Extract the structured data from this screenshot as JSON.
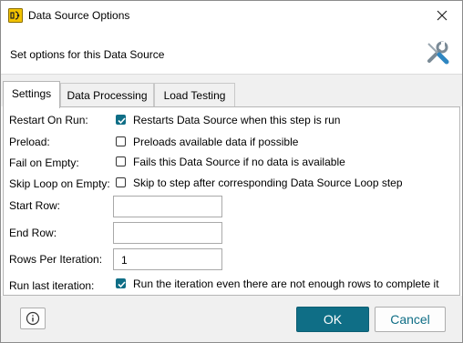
{
  "window": {
    "title": "Data Source Options",
    "icon": "data-source-icon",
    "close_icon": "close-icon"
  },
  "header": {
    "text": "Set options for this Data Source",
    "icon": "tools-icon"
  },
  "tabs": [
    {
      "label": "Settings",
      "active": true
    },
    {
      "label": "Data Processing",
      "active": false
    },
    {
      "label": "Load Testing",
      "active": false
    }
  ],
  "settings": {
    "restart_on_run": {
      "label": "Restart On Run:",
      "checked": true,
      "text": "Restarts Data Source when this step is run"
    },
    "preload": {
      "label": "Preload:",
      "checked": false,
      "text": "Preloads available data if possible"
    },
    "fail_on_empty": {
      "label": "Fail on Empty:",
      "checked": false,
      "text": "Fails this Data Source if no data is available"
    },
    "skip_loop_on_empty": {
      "label": "Skip Loop on Empty:",
      "checked": false,
      "text": "Skip to step after corresponding Data Source Loop step"
    },
    "start_row": {
      "label": "Start Row:",
      "value": ""
    },
    "end_row": {
      "label": "End Row:",
      "value": ""
    },
    "rows_per_iteration": {
      "label": "Rows Per Iteration:",
      "value": "1"
    },
    "run_last_iteration": {
      "label": "Run last iteration:",
      "checked": true,
      "text": "Run the iteration even there are not enough rows to complete it"
    }
  },
  "footer": {
    "info_icon": "info-icon",
    "ok_label": "OK",
    "cancel_label": "Cancel"
  },
  "colors": {
    "accent": "#0f6e86",
    "footer_bg": "#f0f0f0"
  }
}
